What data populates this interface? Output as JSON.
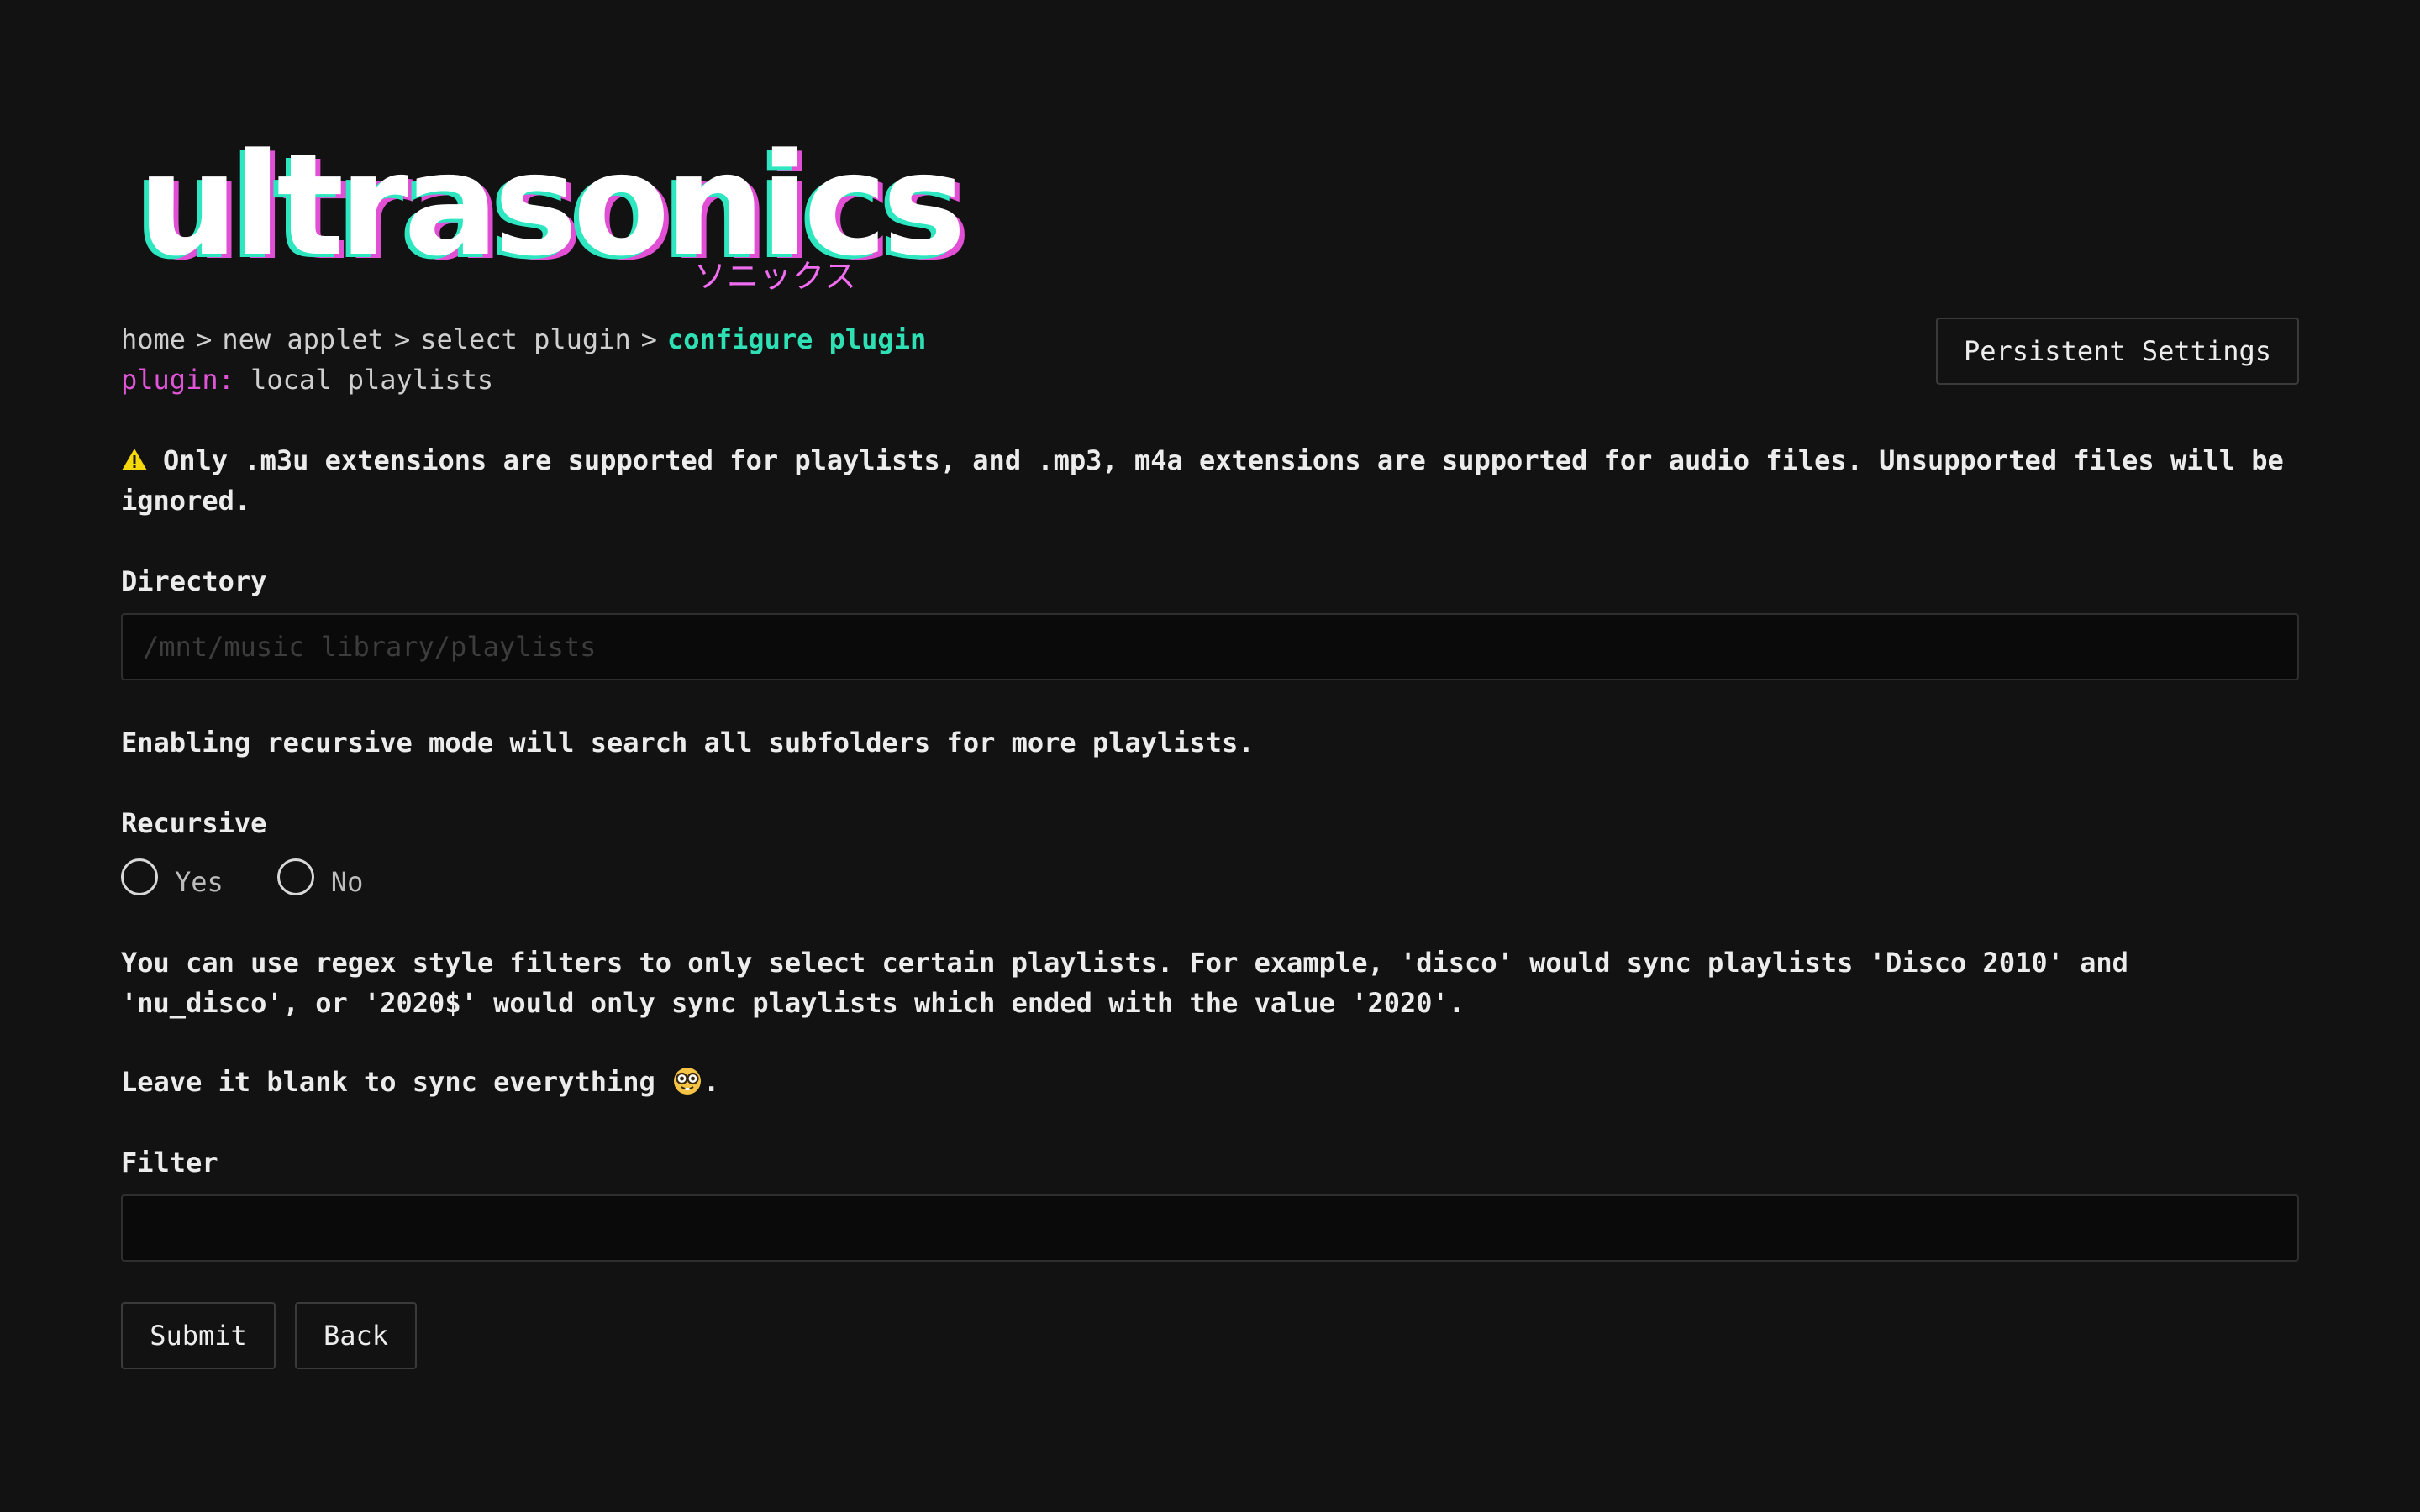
{
  "logo": {
    "wordmark": "ultrasonics",
    "kana": "ソニックス"
  },
  "breadcrumb": {
    "items": [
      "home",
      "new applet",
      "select plugin",
      "configure plugin"
    ],
    "separator": ">"
  },
  "plugin": {
    "key": "plugin:",
    "value": "local playlists"
  },
  "header": {
    "persistent_settings_label": "Persistent Settings"
  },
  "form": {
    "warning_icon": "warning-icon",
    "warning_text": "Only .m3u extensions are supported for playlists, and .mp3, m4a extensions are supported for audio files. Unsupported files will be ignored.",
    "directory": {
      "label": "Directory",
      "placeholder": "/mnt/music library/playlists",
      "value": ""
    },
    "recursive_info": "Enabling recursive mode will search all subfolders for more playlists.",
    "recursive": {
      "label": "Recursive",
      "options": [
        "Yes",
        "No"
      ],
      "selected": null
    },
    "filter_info": "You can use regex style filters to only select certain playlists. For example, 'disco' would sync playlists 'Disco 2010' and 'nu_disco', or '2020$' would only sync playlists which ended with the value '2020'.",
    "blank_info": {
      "text": "Leave it blank to sync everything",
      "emoji": "nerd-face-emoji",
      "suffix": "."
    },
    "filter": {
      "label": "Filter",
      "placeholder": "",
      "value": ""
    },
    "submit_label": "Submit",
    "back_label": "Back"
  },
  "colors": {
    "background": "#121212",
    "accent_teal": "#2fe0b4",
    "accent_magenta": "#e055d8",
    "warning_yellow": "#f5d90a"
  }
}
